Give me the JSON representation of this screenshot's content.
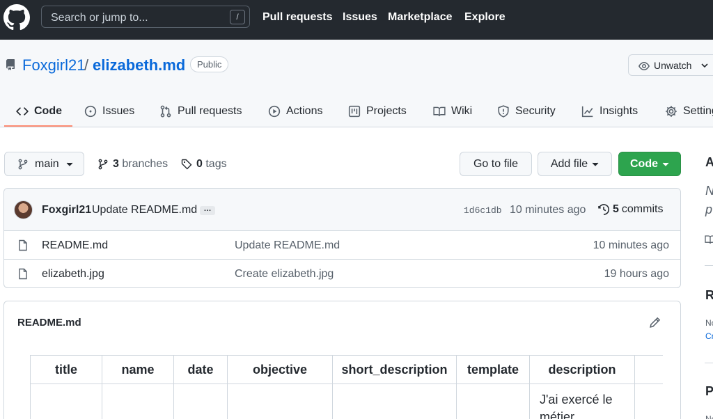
{
  "header": {
    "search_placeholder": "Search or jump to...",
    "search_shortcut": "/",
    "nav": [
      "Pull requests",
      "Issues",
      "Marketplace",
      "Explore"
    ]
  },
  "repo": {
    "owner": "Foxgirl21",
    "separator": "/",
    "name": "elizabeth.md",
    "visibility": "Public",
    "watch_label": "Unwatch"
  },
  "tabs": [
    {
      "label": "Code",
      "icon": "code-icon",
      "active": true
    },
    {
      "label": "Issues",
      "icon": "issue-icon"
    },
    {
      "label": "Pull requests",
      "icon": "pull-request-icon"
    },
    {
      "label": "Actions",
      "icon": "play-icon"
    },
    {
      "label": "Projects",
      "icon": "project-icon"
    },
    {
      "label": "Wiki",
      "icon": "book-icon"
    },
    {
      "label": "Security",
      "icon": "shield-icon"
    },
    {
      "label": "Insights",
      "icon": "graph-icon"
    },
    {
      "label": "Settings",
      "icon": "gear-icon"
    }
  ],
  "filenav": {
    "branch": "main",
    "branches_count": "3",
    "branches_label": "branches",
    "tags_count": "0",
    "tags_label": "tags",
    "go_to_file": "Go to file",
    "add_file": "Add file",
    "code": "Code"
  },
  "commit": {
    "author": "Foxgirl21",
    "message": "Update README.md",
    "ellipsis": "…",
    "sha": "1d6c1db",
    "time": "10 minutes ago",
    "commits_count": "5",
    "commits_label": "commits"
  },
  "files": [
    {
      "name": "README.md",
      "message": "Update README.md",
      "time": "10 minutes ago"
    },
    {
      "name": "elizabeth.jpg",
      "message": "Create elizabeth.jpg",
      "time": "19 hours ago"
    }
  ],
  "readme": {
    "title": "README.md",
    "columns": [
      "title",
      "name",
      "date",
      "objective",
      "short_description",
      "template",
      "description"
    ],
    "row": [
      "",
      "",
      "",
      "",
      "",
      "",
      "J'ai exercé le métier"
    ]
  },
  "sidebar": {
    "about_initial": "A",
    "line1": "N",
    "line2": "p",
    "releases_initial": "R",
    "releases_no": "No",
    "releases_create": "Cr",
    "packages_initial": "P",
    "packages_no": "No"
  },
  "colors": {
    "header_bg": "#24292f",
    "link": "#0969da",
    "green_button": "#2da44e",
    "active_tab_underline": "#fd8c73"
  }
}
